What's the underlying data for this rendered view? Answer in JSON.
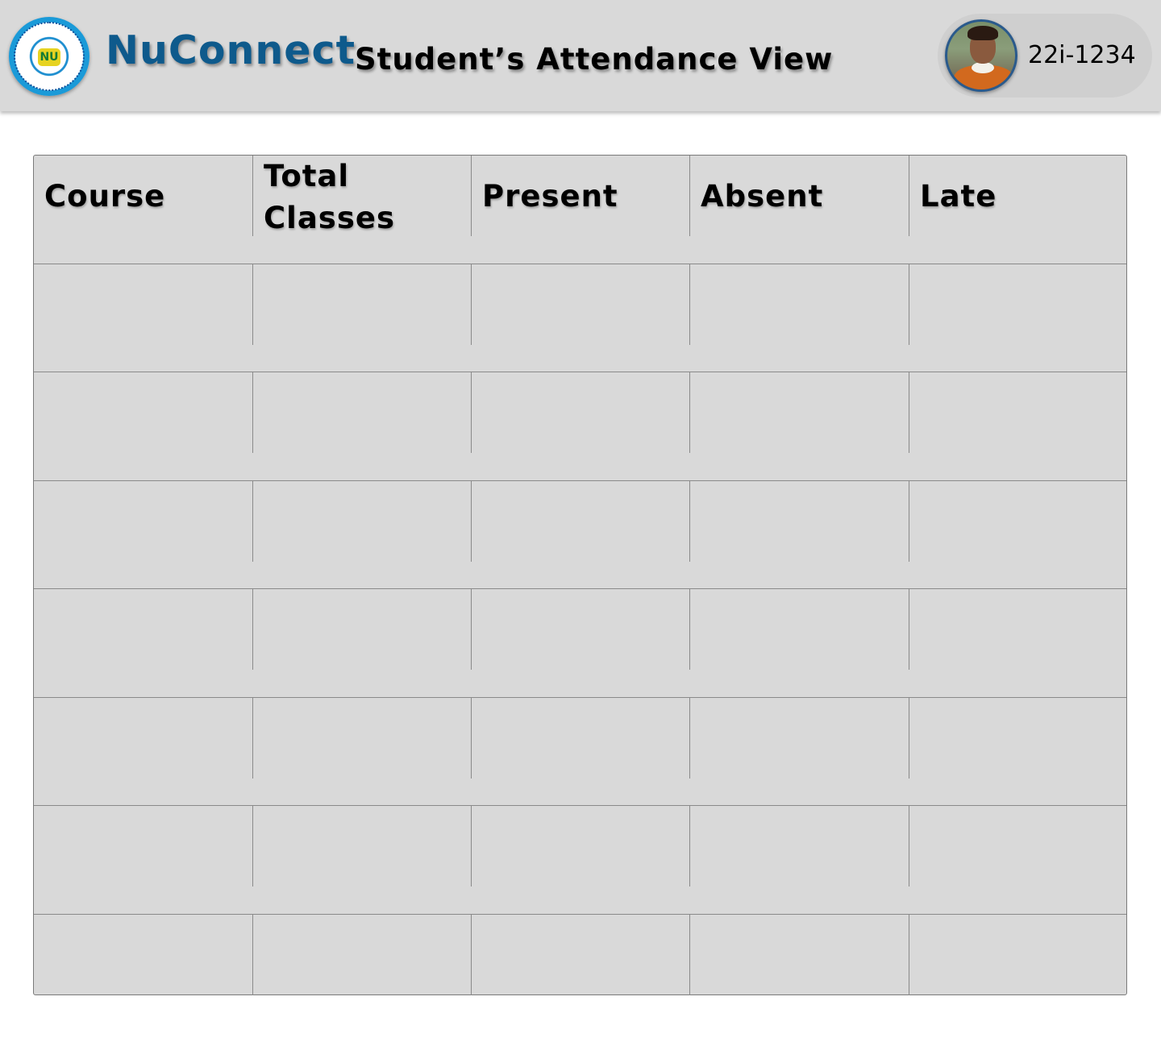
{
  "header": {
    "brand": "NuConnect",
    "page_title": "Student’s Attendance View",
    "logo_icon": "university-seal-logo",
    "logo_mark": "NU"
  },
  "profile": {
    "student_id": "22i-1234",
    "avatar_icon": "student-avatar"
  },
  "table": {
    "columns": [
      "Course",
      "Total Classes",
      "Present",
      "Absent",
      "Late"
    ],
    "rows": [
      [
        "",
        "",
        "",
        "",
        ""
      ],
      [
        "",
        "",
        "",
        "",
        ""
      ],
      [
        "",
        "",
        "",
        "",
        ""
      ],
      [
        "",
        "",
        "",
        "",
        ""
      ],
      [
        "",
        "",
        "",
        "",
        ""
      ],
      [
        "",
        "",
        "",
        "",
        ""
      ],
      [
        "",
        "",
        "",
        "",
        ""
      ]
    ]
  },
  "colors": {
    "header_bg": "#d9d9d9",
    "brand": "#0e5a8c",
    "table_bg": "#d9d9d9",
    "grid_line": "#8a8a8a",
    "avatar_border": "#2a5a8c"
  }
}
